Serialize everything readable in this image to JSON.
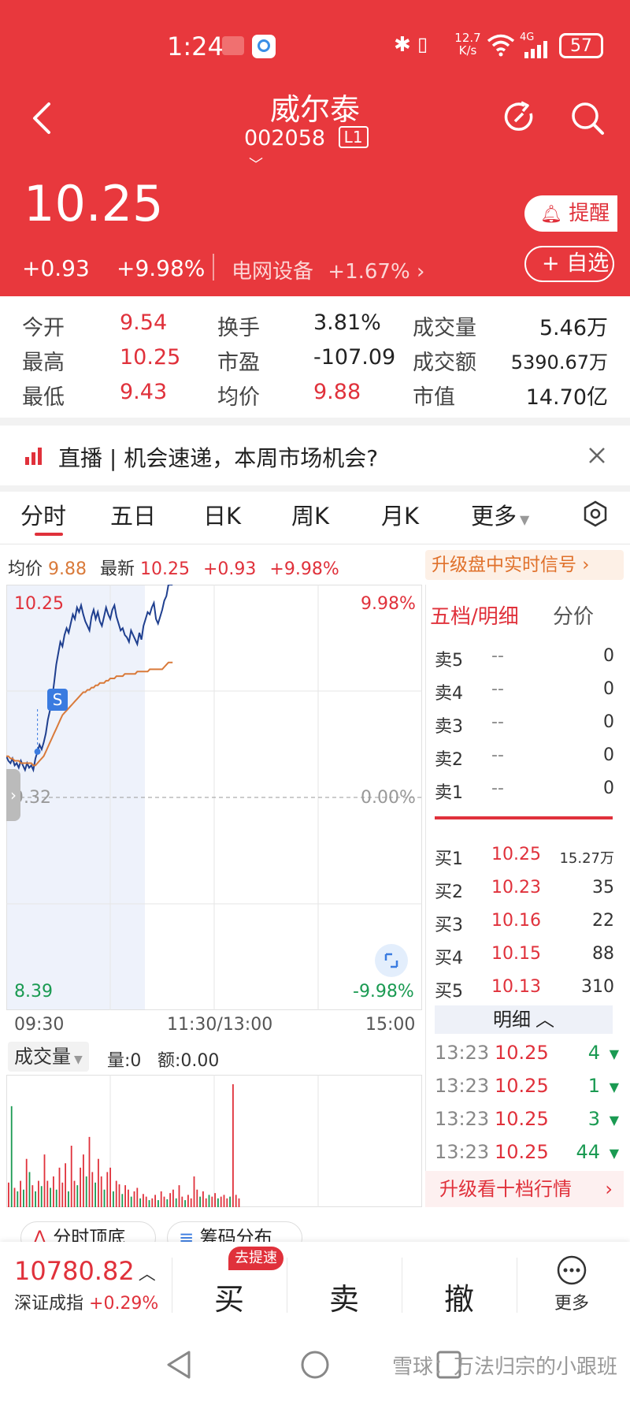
{
  "status_bar": {
    "time": "1:24",
    "network_speed": "12.7",
    "network_unit": "K/s",
    "signal": "4G",
    "battery": "57"
  },
  "header": {
    "stock_name": "威尔泰",
    "stock_code": "002058",
    "level_badge": "L1",
    "price": "10.25",
    "change": "+0.93",
    "change_pct": "+9.98%",
    "sector_name": "电网设备",
    "sector_pct": "+1.67%",
    "remind_label": "提醒",
    "watchlist_label": "自选"
  },
  "stats": {
    "open_label": "今开",
    "open_value": "9.54",
    "high_label": "最高",
    "high_value": "10.25",
    "low_label": "最低",
    "low_value": "9.43",
    "turnover_label": "换手",
    "turnover_value": "3.81%",
    "pe_label": "市盈",
    "pe_value": "-107.09",
    "avg_label": "均价",
    "avg_value": "9.88",
    "volume_label": "成交量",
    "volume_value": "5.46万",
    "amount_label": "成交额",
    "amount_value": "5390.67万",
    "mcap_label": "市值",
    "mcap_value": "14.70亿"
  },
  "live_banner": {
    "text": "直播 | 机会速递，本周市场机会?"
  },
  "tabs": [
    "分时",
    "五日",
    "日K",
    "周K",
    "月K",
    "更多"
  ],
  "chart_header": {
    "avg_label": "均价",
    "avg_value": "9.88",
    "latest_label": "最新",
    "latest_value": "10.25",
    "change": "+0.93",
    "change_pct": "+9.98%",
    "upgrade_label": "升级盘中实时信号"
  },
  "chart_data": {
    "type": "line",
    "y_top_label": "10.25",
    "y_mid_label": "9.32",
    "y_bottom_label": "8.39",
    "pct_top_label": "9.98%",
    "pct_mid_label": "0.00%",
    "pct_bottom_label": "-9.98%",
    "ylim": [
      8.39,
      10.25
    ],
    "x_labels": [
      "09:30",
      "11:30/13:00",
      "15:00"
    ],
    "signal_label": "S",
    "series": [
      {
        "values": [
          9.5,
          9.48,
          9.47,
          9.49,
          9.46,
          9.47,
          9.45,
          9.48,
          9.46,
          9.44,
          9.47,
          9.45,
          9.46,
          9.44,
          9.49,
          9.52,
          9.55,
          9.53,
          9.56,
          9.6,
          9.66,
          9.7,
          9.75,
          9.82,
          9.9,
          9.95,
          10.0,
          9.98,
          10.03,
          10.06,
          10.04,
          10.08,
          10.12,
          10.1,
          10.15,
          10.13,
          10.16,
          10.12,
          10.09,
          10.07,
          10.05,
          10.11,
          10.14,
          10.1,
          10.13,
          10.09,
          10.07,
          10.11,
          10.15,
          10.12,
          10.1,
          10.14,
          10.16,
          10.11,
          10.08,
          10.05,
          10.06,
          10.03,
          10.02,
          10.0,
          10.05,
          10.03,
          10.01,
          9.99,
          10.04,
          10.01,
          10.07,
          10.1,
          10.13,
          10.12,
          10.15,
          10.17,
          10.1,
          10.08,
          10.11,
          10.14,
          10.18,
          10.2,
          10.25,
          10.25,
          10.25
        ]
      },
      {
        "values": [
          9.5,
          9.5,
          9.49,
          9.49,
          9.48,
          9.48,
          9.48,
          9.47,
          9.47,
          9.47,
          9.47,
          9.47,
          9.47,
          9.46,
          9.46,
          9.47,
          9.48,
          9.49,
          9.5,
          9.52,
          9.54,
          9.56,
          9.58,
          9.6,
          9.62,
          9.64,
          9.66,
          9.68,
          9.69,
          9.7,
          9.71,
          9.72,
          9.73,
          9.74,
          9.75,
          9.76,
          9.77,
          9.78,
          9.78,
          9.79,
          9.79,
          9.8,
          9.8,
          9.81,
          9.81,
          9.82,
          9.82,
          9.82,
          9.83,
          9.83,
          9.84,
          9.84,
          9.84,
          9.85,
          9.85,
          9.85,
          9.85,
          9.86,
          9.86,
          9.86,
          9.86,
          9.86,
          9.86,
          9.87,
          9.87,
          9.87,
          9.87,
          9.87,
          9.87,
          9.88,
          9.88,
          9.88,
          9.88,
          9.88,
          9.88,
          9.88,
          9.89,
          9.9,
          9.91,
          9.91,
          9.91
        ]
      }
    ]
  },
  "volume_panel": {
    "label": "成交量",
    "qty_label": "量:0",
    "amount_label": "额:0.00",
    "bars": [
      {
        "v": 28,
        "c": "red"
      },
      {
        "v": 115,
        "c": "green"
      },
      {
        "v": 22,
        "c": "red"
      },
      {
        "v": 18,
        "c": "green"
      },
      {
        "v": 30,
        "c": "red"
      },
      {
        "v": 20,
        "c": "green"
      },
      {
        "v": 55,
        "c": "red"
      },
      {
        "v": 40,
        "c": "green"
      },
      {
        "v": 25,
        "c": "red"
      },
      {
        "v": 18,
        "c": "green"
      },
      {
        "v": 30,
        "c": "red"
      },
      {
        "v": 24,
        "c": "green"
      },
      {
        "v": 60,
        "c": "red"
      },
      {
        "v": 30,
        "c": "red"
      },
      {
        "v": 22,
        "c": "green"
      },
      {
        "v": 35,
        "c": "red"
      },
      {
        "v": 20,
        "c": "green"
      },
      {
        "v": 45,
        "c": "red"
      },
      {
        "v": 28,
        "c": "red"
      },
      {
        "v": 50,
        "c": "red"
      },
      {
        "v": 18,
        "c": "green"
      },
      {
        "v": 70,
        "c": "red"
      },
      {
        "v": 30,
        "c": "red"
      },
      {
        "v": 25,
        "c": "green"
      },
      {
        "v": 45,
        "c": "red"
      },
      {
        "v": 60,
        "c": "red"
      },
      {
        "v": 35,
        "c": "green"
      },
      {
        "v": 80,
        "c": "red"
      },
      {
        "v": 40,
        "c": "red"
      },
      {
        "v": 28,
        "c": "green"
      },
      {
        "v": 55,
        "c": "red"
      },
      {
        "v": 35,
        "c": "red"
      },
      {
        "v": 20,
        "c": "green"
      },
      {
        "v": 40,
        "c": "red"
      },
      {
        "v": 45,
        "c": "red"
      },
      {
        "v": 18,
        "c": "green"
      },
      {
        "v": 30,
        "c": "red"
      },
      {
        "v": 26,
        "c": "red"
      },
      {
        "v": 15,
        "c": "green"
      },
      {
        "v": 25,
        "c": "red"
      },
      {
        "v": 20,
        "c": "red"
      },
      {
        "v": 12,
        "c": "green"
      },
      {
        "v": 18,
        "c": "red"
      },
      {
        "v": 22,
        "c": "red"
      },
      {
        "v": 10,
        "c": "green"
      },
      {
        "v": 15,
        "c": "red"
      },
      {
        "v": 12,
        "c": "red"
      },
      {
        "v": 8,
        "c": "green"
      },
      {
        "v": 10,
        "c": "red"
      },
      {
        "v": 14,
        "c": "red"
      },
      {
        "v": 8,
        "c": "green"
      },
      {
        "v": 18,
        "c": "red"
      },
      {
        "v": 12,
        "c": "red"
      },
      {
        "v": 9,
        "c": "green"
      },
      {
        "v": 16,
        "c": "red"
      },
      {
        "v": 20,
        "c": "red"
      },
      {
        "v": 10,
        "c": "green"
      },
      {
        "v": 25,
        "c": "red"
      },
      {
        "v": 12,
        "c": "red"
      },
      {
        "v": 8,
        "c": "green"
      },
      {
        "v": 14,
        "c": "red"
      },
      {
        "v": 10,
        "c": "red"
      },
      {
        "v": 35,
        "c": "red"
      },
      {
        "v": 20,
        "c": "red"
      },
      {
        "v": 12,
        "c": "green"
      },
      {
        "v": 18,
        "c": "red"
      },
      {
        "v": 10,
        "c": "red"
      },
      {
        "v": 14,
        "c": "green"
      },
      {
        "v": 12,
        "c": "red"
      },
      {
        "v": 16,
        "c": "red"
      },
      {
        "v": 10,
        "c": "green"
      },
      {
        "v": 12,
        "c": "red"
      },
      {
        "v": 14,
        "c": "red"
      },
      {
        "v": 10,
        "c": "red"
      },
      {
        "v": 12,
        "c": "green"
      },
      {
        "v": 140,
        "c": "red"
      },
      {
        "v": 14,
        "c": "red"
      },
      {
        "v": 10,
        "c": "red"
      }
    ]
  },
  "order_book": {
    "header_left": "五档/明细",
    "header_right": "分价",
    "sells": [
      {
        "label": "卖5",
        "price": "--",
        "qty": "0"
      },
      {
        "label": "卖4",
        "price": "--",
        "qty": "0"
      },
      {
        "label": "卖3",
        "price": "--",
        "qty": "0"
      },
      {
        "label": "卖2",
        "price": "--",
        "qty": "0"
      },
      {
        "label": "卖1",
        "price": "--",
        "qty": "0"
      }
    ],
    "buys": [
      {
        "label": "买1",
        "price": "10.25",
        "qty": "15.27万"
      },
      {
        "label": "买2",
        "price": "10.23",
        "qty": "35"
      },
      {
        "label": "买3",
        "price": "10.16",
        "qty": "22"
      },
      {
        "label": "买4",
        "price": "10.15",
        "qty": "88"
      },
      {
        "label": "买5",
        "price": "10.13",
        "qty": "310"
      }
    ],
    "detail_label": "明细",
    "trades": [
      {
        "time": "13:23",
        "price": "10.25",
        "qty": "4"
      },
      {
        "time": "13:23",
        "price": "10.25",
        "qty": "1"
      },
      {
        "time": "13:23",
        "price": "10.25",
        "qty": "3"
      },
      {
        "time": "13:23",
        "price": "10.25",
        "qty": "44"
      }
    ],
    "upgrade_label": "升级看十档行情"
  },
  "chips": [
    "分时顶底",
    "筹码分布"
  ],
  "bottom_bar": {
    "index_value": "10780.82",
    "index_name": "深证成指",
    "index_pct": "+0.29%",
    "buy_label": "买",
    "buy_badge": "去提速",
    "sell_label": "卖",
    "cancel_label": "撤",
    "more_label": "更多"
  },
  "watermark": "雪球：万法归宗的小跟班",
  "colors": {
    "header_red": "#e8383d",
    "up_red": "#e0313b",
    "down_green": "#1a9a52",
    "price_line": "#1f3f8f",
    "avg_line": "#d97a3a"
  }
}
